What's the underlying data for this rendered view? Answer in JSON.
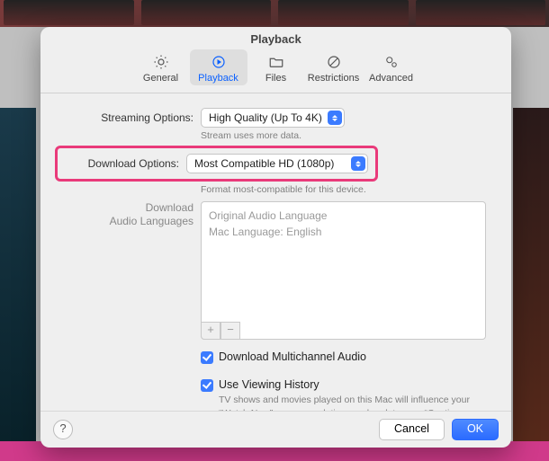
{
  "window_title": "Playback",
  "toolbar": {
    "items": [
      {
        "name": "general",
        "label": "General"
      },
      {
        "name": "playback",
        "label": "Playback",
        "selected": true
      },
      {
        "name": "files",
        "label": "Files"
      },
      {
        "name": "restrictions",
        "label": "Restrictions"
      },
      {
        "name": "advanced",
        "label": "Advanced"
      }
    ]
  },
  "streaming": {
    "label": "Streaming Options:",
    "value": "High Quality (Up To 4K)",
    "hint": "Stream uses more data."
  },
  "download": {
    "label": "Download Options:",
    "value": "Most Compatible HD (1080p)",
    "hint": "Format most-compatible for this device."
  },
  "audio_langs": {
    "label": "Download\nAudio Languages",
    "line1": "Original Audio Language",
    "line2": "Mac Language: English",
    "add_symbol": "+",
    "remove_symbol": "−"
  },
  "multichannel": {
    "label": "Download Multichannel Audio",
    "checked": true
  },
  "viewing_history": {
    "label": "Use Viewing History",
    "checked": true,
    "desc": "TV shows and movies played on this Mac will influence your “Watch Now” recommendations and update your “Continue Watching” across your devices."
  },
  "footer": {
    "help": "?",
    "cancel": "Cancel",
    "ok": "OK"
  }
}
